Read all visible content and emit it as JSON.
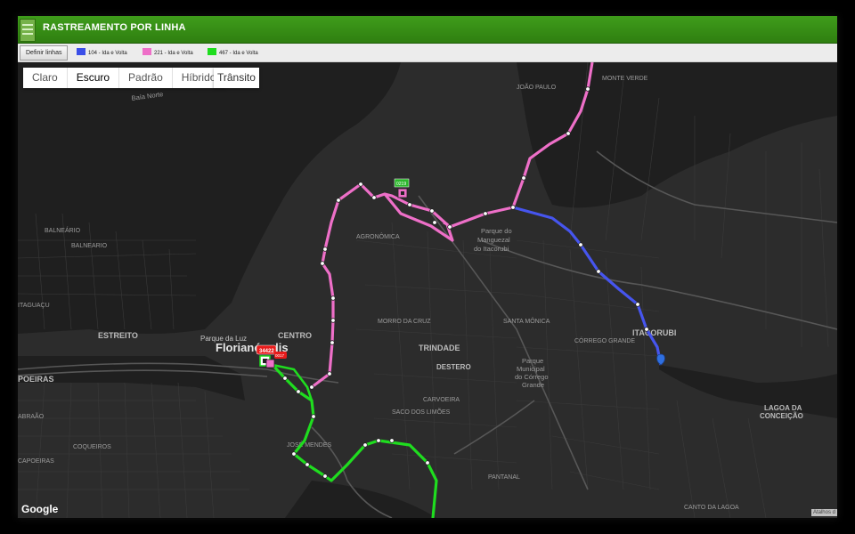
{
  "header": {
    "title": "RASTREAMENTO POR LINHA"
  },
  "toolbar": {
    "define_button": "Definir linhas",
    "legend": [
      {
        "label": "104 - Ida e Volta",
        "color": "#3b4fe8"
      },
      {
        "label": "221 - Ida e Volta",
        "color": "#ee6fc8"
      },
      {
        "label": "467 - Ida e Volta",
        "color": "#1fdd1f"
      }
    ]
  },
  "map_controls": {
    "types": [
      "Claro",
      "Escuro",
      "Padrão",
      "Híbrido"
    ],
    "selected": "Escuro",
    "transit": "Trânsito"
  },
  "map_labels": {
    "florianopolis": "Florianópolis",
    "centro": "CENTRO",
    "estreito": "ESTREITO",
    "trindade": "TRINDADE",
    "itacorubi": "ITACORUBI",
    "lagoa1": "LAGOA DA",
    "lagoa2": "CONCEIÇÃO",
    "destero": "DESTERO",
    "coqueiros": "COQUEIROS",
    "poeiras": "POEIRAS",
    "balneario1": "BALNEÁRIO",
    "balneario2": "BALNEARIO",
    "agronomica": "AGRONÔMICA",
    "morro": "MORRO DA CRUZ",
    "santa_monica": "SANTA MÔNICA",
    "corrego": "CÓRREGO GRANDE",
    "parque_luz": "Parque da Luz",
    "parque_mang1": "Parque do",
    "parque_mang2": "Manguezal",
    "parque_mang3": "do Itacorubi",
    "parque_mun1": "Parque",
    "parque_mun2": "Municipal",
    "parque_mun3": "do Córrego",
    "parque_mun4": "Grande",
    "joao_paulo": "JOÃO PAULO",
    "monte_verde": "MONTE VERDE",
    "carvoeira": "CARVOEIRA",
    "saco": "SACO DOS LIMÕES",
    "jose_mendes": "JOSÉ MENDES",
    "pantanal": "PANTANAL",
    "canto": "CANTO DA LAGOA",
    "baia_norte": "Baía Norte",
    "itaguacu": "ITAGUAÇU",
    "abraao": "ABRAÃO",
    "capoeiras": "CAPOEIRAS"
  },
  "vehicles": [
    {
      "id": "34422",
      "color": "#e81b1b"
    },
    {
      "id": "0219",
      "color": "#2bb52b"
    },
    {
      "id": "0017",
      "color": "#e81b1b"
    }
  ],
  "footer": {
    "google": "Google",
    "attribution": "Atalhos d"
  }
}
